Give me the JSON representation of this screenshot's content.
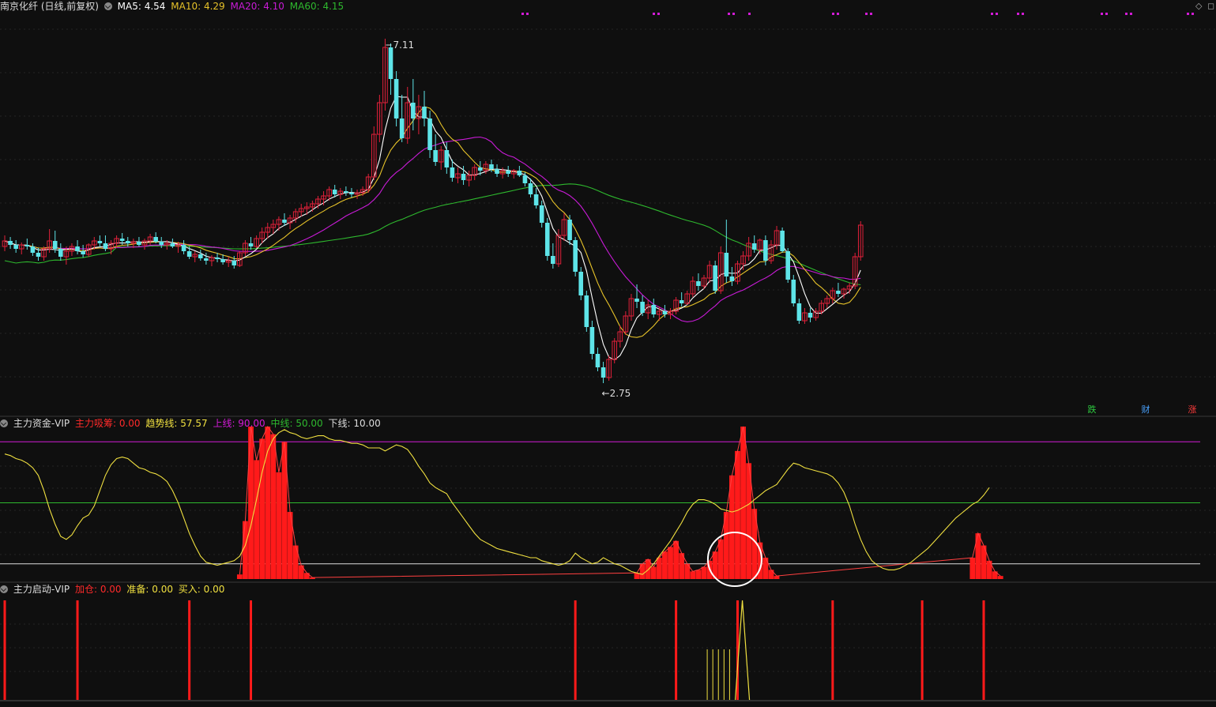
{
  "header": {
    "title": "南京化纤 (日线,前复权)",
    "ma": [
      {
        "label": "MA5: 4.54",
        "color": "#ffffff"
      },
      {
        "label": "MA10: 4.29",
        "color": "#e6c229"
      },
      {
        "label": "MA20: 4.10",
        "color": "#c81bd6"
      },
      {
        "label": "MA60: 4.15",
        "color": "#2eb82e"
      }
    ]
  },
  "price_labels": {
    "high": "7.11",
    "low": "2.75"
  },
  "right_badges": [
    {
      "label": "跌",
      "color": "#2ecc40"
    },
    {
      "label": "财",
      "color": "#4aa3ff"
    },
    {
      "label": "涨",
      "color": "#ff3b3b"
    }
  ],
  "panel2": {
    "title": "主力资金-VIP",
    "items": [
      {
        "label": "主力吸筹: 0.00",
        "color": "#ff2a2a"
      },
      {
        "label": "趋势线: 57.57",
        "color": "#f0e040"
      },
      {
        "label": "上线: 90.00",
        "color": "#d21bd6"
      },
      {
        "label": "中线: 50.00",
        "color": "#2eb82e"
      },
      {
        "label": "下线: 10.00",
        "color": "#dddddd"
      }
    ]
  },
  "panel3": {
    "title": "主力启动-VIP",
    "items": [
      {
        "label": "加仓: 0.00",
        "color": "#ff2a2a"
      },
      {
        "label": "准备: 0.00",
        "color": "#f0e040"
      },
      {
        "label": "买入: 0.00",
        "color": "#f0e040"
      }
    ]
  },
  "chart_data": [
    {
      "type": "candlestick",
      "title": "南京化纤 (日线,前复权)",
      "ylim": [
        2.5,
        7.4
      ],
      "y_markers": {
        "max": 7.11,
        "min": 2.75
      },
      "ohlc": [
        [
          4.48,
          4.62,
          4.42,
          4.55
        ],
        [
          4.55,
          4.6,
          4.45,
          4.5
        ],
        [
          4.5,
          4.56,
          4.4,
          4.45
        ],
        [
          4.45,
          4.53,
          4.38,
          4.5
        ],
        [
          4.5,
          4.58,
          4.44,
          4.48
        ],
        [
          4.48,
          4.52,
          4.36,
          4.4
        ],
        [
          4.4,
          4.46,
          4.3,
          4.35
        ],
        [
          4.35,
          4.48,
          4.3,
          4.45
        ],
        [
          4.45,
          4.7,
          4.4,
          4.55
        ],
        [
          4.55,
          4.68,
          4.4,
          4.45
        ],
        [
          4.45,
          4.52,
          4.3,
          4.35
        ],
        [
          4.35,
          4.48,
          4.25,
          4.42
        ],
        [
          4.42,
          4.52,
          4.36,
          4.48
        ],
        [
          4.48,
          4.56,
          4.38,
          4.42
        ],
        [
          4.42,
          4.5,
          4.34,
          4.38
        ],
        [
          4.38,
          4.52,
          4.35,
          4.5
        ],
        [
          4.5,
          4.6,
          4.44,
          4.55
        ],
        [
          4.55,
          4.62,
          4.47,
          4.52
        ],
        [
          4.52,
          4.62,
          4.42,
          4.45
        ],
        [
          4.45,
          4.56,
          4.38,
          4.52
        ],
        [
          4.52,
          4.62,
          4.46,
          4.58
        ],
        [
          4.58,
          4.65,
          4.5,
          4.55
        ],
        [
          4.55,
          4.6,
          4.48,
          4.52
        ],
        [
          4.52,
          4.58,
          4.46,
          4.54
        ],
        [
          4.54,
          4.6,
          4.48,
          4.5
        ],
        [
          4.5,
          4.58,
          4.44,
          4.55
        ],
        [
          4.55,
          4.64,
          4.5,
          4.6
        ],
        [
          4.6,
          4.66,
          4.52,
          4.54
        ],
        [
          4.54,
          4.6,
          4.46,
          4.5
        ],
        [
          4.5,
          4.56,
          4.44,
          4.52
        ],
        [
          4.52,
          4.58,
          4.46,
          4.48
        ],
        [
          4.48,
          4.54,
          4.4,
          4.5
        ],
        [
          4.5,
          4.56,
          4.38,
          4.42
        ],
        [
          4.42,
          4.48,
          4.32,
          4.35
        ],
        [
          4.35,
          4.42,
          4.28,
          4.38
        ],
        [
          4.38,
          4.44,
          4.3,
          4.33
        ],
        [
          4.33,
          4.4,
          4.25,
          4.3
        ],
        [
          4.3,
          4.37,
          4.23,
          4.34
        ],
        [
          4.34,
          4.4,
          4.28,
          4.32
        ],
        [
          4.32,
          4.38,
          4.25,
          4.28
        ],
        [
          4.28,
          4.35,
          4.22,
          4.3
        ],
        [
          4.3,
          4.36,
          4.2,
          4.24
        ],
        [
          4.24,
          4.42,
          4.22,
          4.4
        ],
        [
          4.4,
          4.56,
          4.36,
          4.52
        ],
        [
          4.52,
          4.6,
          4.44,
          4.48
        ],
        [
          4.48,
          4.62,
          4.46,
          4.58
        ],
        [
          4.58,
          4.72,
          4.52,
          4.66
        ],
        [
          4.66,
          4.78,
          4.58,
          4.72
        ],
        [
          4.72,
          4.82,
          4.64,
          4.76
        ],
        [
          4.76,
          4.86,
          4.68,
          4.82
        ],
        [
          4.82,
          4.9,
          4.74,
          4.78
        ],
        [
          4.78,
          4.88,
          4.7,
          4.84
        ],
        [
          4.84,
          4.96,
          4.78,
          4.92
        ],
        [
          4.92,
          5.02,
          4.86,
          4.96
        ],
        [
          4.96,
          5.04,
          4.88,
          4.98
        ],
        [
          4.98,
          5.06,
          4.92,
          5.02
        ],
        [
          5.02,
          5.12,
          4.96,
          5.08
        ],
        [
          5.08,
          5.18,
          5.0,
          5.12
        ],
        [
          5.12,
          5.24,
          5.06,
          5.2
        ],
        [
          5.2,
          5.26,
          5.1,
          5.14
        ],
        [
          5.14,
          5.22,
          5.08,
          5.18
        ],
        [
          5.18,
          5.24,
          5.12,
          5.16
        ],
        [
          5.16,
          5.22,
          5.1,
          5.14
        ],
        [
          5.14,
          5.2,
          5.08,
          5.16
        ],
        [
          5.16,
          5.24,
          5.12,
          5.2
        ],
        [
          5.2,
          5.4,
          5.16,
          5.36
        ],
        [
          5.36,
          6.0,
          5.32,
          5.9
        ],
        [
          5.9,
          6.4,
          5.8,
          6.3
        ],
        [
          6.3,
          7.11,
          6.2,
          7.0
        ],
        [
          7.0,
          7.05,
          6.4,
          6.6
        ],
        [
          6.6,
          6.7,
          6.0,
          6.1
        ],
        [
          6.1,
          6.4,
          5.8,
          5.85
        ],
        [
          5.85,
          6.5,
          5.78,
          6.3
        ],
        [
          6.3,
          6.6,
          5.95,
          6.1
        ],
        [
          6.1,
          6.4,
          5.9,
          6.25
        ],
        [
          6.25,
          6.45,
          6.0,
          6.1
        ],
        [
          6.1,
          6.2,
          5.6,
          5.7
        ],
        [
          5.7,
          5.9,
          5.5,
          5.55
        ],
        [
          5.55,
          5.75,
          5.45,
          5.7
        ],
        [
          5.7,
          5.8,
          5.4,
          5.48
        ],
        [
          5.48,
          5.58,
          5.3,
          5.35
        ],
        [
          5.35,
          5.48,
          5.28,
          5.4
        ],
        [
          5.4,
          5.5,
          5.26,
          5.32
        ],
        [
          5.32,
          5.44,
          5.24,
          5.38
        ],
        [
          5.38,
          5.52,
          5.32,
          5.48
        ],
        [
          5.48,
          5.56,
          5.38,
          5.44
        ],
        [
          5.44,
          5.56,
          5.4,
          5.52
        ],
        [
          5.52,
          5.58,
          5.42,
          5.46
        ],
        [
          5.46,
          5.52,
          5.36,
          5.4
        ],
        [
          5.4,
          5.48,
          5.34,
          5.44
        ],
        [
          5.44,
          5.5,
          5.36,
          5.4
        ],
        [
          5.4,
          5.46,
          5.34,
          5.44
        ],
        [
          5.44,
          5.5,
          5.36,
          5.38
        ],
        [
          5.38,
          5.42,
          5.24,
          5.28
        ],
        [
          5.28,
          5.34,
          5.1,
          5.14
        ],
        [
          5.14,
          5.22,
          4.96,
          5.0
        ],
        [
          5.0,
          5.06,
          4.72,
          4.78
        ],
        [
          4.78,
          4.84,
          4.3,
          4.36
        ],
        [
          4.36,
          4.52,
          4.2,
          4.26
        ],
        [
          4.26,
          4.7,
          4.22,
          4.62
        ],
        [
          4.62,
          4.9,
          4.55,
          4.82
        ],
        [
          4.82,
          4.88,
          4.5,
          4.56
        ],
        [
          4.56,
          4.6,
          4.1,
          4.16
        ],
        [
          4.16,
          4.22,
          3.8,
          3.86
        ],
        [
          3.86,
          3.92,
          3.4,
          3.46
        ],
        [
          3.46,
          3.54,
          3.05,
          3.12
        ],
        [
          3.12,
          3.2,
          2.9,
          2.95
        ],
        [
          2.95,
          3.02,
          2.75,
          2.82
        ],
        [
          2.82,
          3.1,
          2.78,
          3.05
        ],
        [
          3.05,
          3.32,
          3.0,
          3.28
        ],
        [
          3.28,
          3.48,
          3.2,
          3.4
        ],
        [
          3.4,
          3.66,
          3.36,
          3.6
        ],
        [
          3.6,
          3.88,
          3.54,
          3.82
        ],
        [
          3.82,
          4.0,
          3.7,
          3.78
        ],
        [
          3.78,
          3.86,
          3.6,
          3.64
        ],
        [
          3.64,
          3.8,
          3.56,
          3.74
        ],
        [
          3.74,
          3.82,
          3.58,
          3.62
        ],
        [
          3.62,
          3.72,
          3.54,
          3.66
        ],
        [
          3.66,
          3.74,
          3.58,
          3.62
        ],
        [
          3.62,
          3.7,
          3.56,
          3.66
        ],
        [
          3.66,
          3.84,
          3.62,
          3.8
        ],
        [
          3.8,
          3.9,
          3.72,
          3.76
        ],
        [
          3.76,
          3.92,
          3.74,
          3.88
        ],
        [
          3.88,
          4.1,
          3.84,
          4.04
        ],
        [
          4.04,
          4.14,
          3.92,
          3.98
        ],
        [
          3.98,
          4.12,
          3.94,
          4.08
        ],
        [
          4.08,
          4.3,
          4.02,
          4.24
        ],
        [
          4.24,
          4.3,
          3.88,
          3.92
        ],
        [
          3.92,
          4.48,
          3.88,
          4.4
        ],
        [
          4.4,
          4.82,
          4.02,
          4.1
        ],
        [
          4.1,
          4.22,
          3.98,
          4.04
        ],
        [
          4.04,
          4.3,
          4.0,
          4.26
        ],
        [
          4.26,
          4.42,
          4.18,
          4.36
        ],
        [
          4.36,
          4.6,
          4.3,
          4.52
        ],
        [
          4.52,
          4.62,
          4.4,
          4.44
        ],
        [
          4.44,
          4.58,
          4.38,
          4.56
        ],
        [
          4.56,
          4.62,
          4.24,
          4.3
        ],
        [
          4.3,
          4.56,
          4.26,
          4.5
        ],
        [
          4.5,
          4.74,
          4.44,
          4.68
        ],
        [
          4.68,
          4.72,
          4.4,
          4.42
        ],
        [
          4.42,
          4.46,
          4.02,
          4.06
        ],
        [
          4.06,
          4.12,
          3.72,
          3.76
        ],
        [
          3.76,
          3.82,
          3.5,
          3.54
        ],
        [
          3.54,
          3.7,
          3.5,
          3.64
        ],
        [
          3.64,
          3.7,
          3.52,
          3.58
        ],
        [
          3.58,
          3.7,
          3.54,
          3.66
        ],
        [
          3.66,
          3.8,
          3.62,
          3.76
        ],
        [
          3.76,
          3.86,
          3.7,
          3.82
        ],
        [
          3.82,
          3.96,
          3.76,
          3.92
        ],
        [
          3.92,
          4.02,
          3.84,
          3.88
        ],
        [
          3.88,
          3.96,
          3.82,
          3.94
        ],
        [
          3.94,
          4.02,
          3.88,
          3.98
        ],
        [
          3.98,
          4.4,
          3.94,
          4.35
        ],
        [
          4.35,
          4.8,
          4.3,
          4.75
        ]
      ],
      "ma": {
        "MA5": 4.54,
        "MA10": 4.29,
        "MA20": 4.1,
        "MA60": 4.15
      }
    },
    {
      "type": "bar+line",
      "title": "主力资金-VIP",
      "ylim": [
        0,
        100
      ],
      "hlines": {
        "上线": 90,
        "中线": 50,
        "下线": 10
      },
      "trend_line": [
        82,
        81,
        79,
        78,
        76,
        73,
        68,
        58,
        46,
        36,
        28,
        26,
        29,
        35,
        40,
        42,
        48,
        58,
        68,
        75,
        79,
        80,
        79,
        76,
        73,
        72,
        70,
        69,
        67,
        64,
        58,
        50,
        40,
        30,
        22,
        15,
        11,
        10,
        9,
        10,
        11,
        12,
        15,
        22,
        35,
        52,
        70,
        84,
        92,
        96,
        98,
        96,
        95,
        93,
        92,
        93,
        94,
        94,
        92,
        91,
        91,
        90,
        89,
        89,
        88,
        86,
        86,
        86,
        84,
        86,
        88,
        87,
        85,
        80,
        74,
        69,
        63,
        60,
        58,
        56,
        50,
        45,
        40,
        35,
        30,
        26,
        24,
        22,
        20,
        19,
        18,
        17,
        16,
        15,
        14,
        14,
        12,
        11,
        10,
        9,
        10,
        12,
        17,
        14,
        12,
        10,
        11,
        14,
        12,
        10,
        9,
        7,
        5,
        4,
        3,
        6,
        10,
        15,
        20,
        25,
        31,
        37,
        44,
        49,
        52,
        52,
        51,
        49,
        46,
        45,
        44,
        45,
        47,
        49,
        52,
        55,
        58,
        60,
        62,
        67,
        72,
        76,
        75,
        73,
        72,
        71,
        70,
        69,
        67,
        63,
        57,
        48,
        36,
        26,
        18,
        12,
        9,
        7,
        6,
        6,
        7,
        9,
        11,
        14,
        17,
        20,
        24,
        28,
        32,
        36,
        40,
        43,
        46,
        49,
        51,
        55,
        60
      ],
      "accumulation_bars": [
        [
          42,
          3
        ],
        [
          43,
          38
        ],
        [
          44,
          100
        ],
        [
          45,
          78
        ],
        [
          46,
          92
        ],
        [
          47,
          100
        ],
        [
          48,
          95
        ],
        [
          49,
          70
        ],
        [
          50,
          90
        ],
        [
          51,
          44
        ],
        [
          52,
          22
        ],
        [
          53,
          9
        ],
        [
          54,
          4
        ],
        [
          55,
          1
        ],
        [
          113,
          4
        ],
        [
          114,
          10
        ],
        [
          115,
          13
        ],
        [
          116,
          8
        ],
        [
          117,
          14
        ],
        [
          118,
          18
        ],
        [
          119,
          21
        ],
        [
          120,
          25
        ],
        [
          121,
          17
        ],
        [
          122,
          10
        ],
        [
          123,
          5
        ],
        [
          124,
          6
        ],
        [
          125,
          8
        ],
        [
          126,
          12
        ],
        [
          127,
          18
        ],
        [
          128,
          26
        ],
        [
          129,
          44
        ],
        [
          130,
          68
        ],
        [
          131,
          84
        ],
        [
          132,
          100
        ],
        [
          133,
          76
        ],
        [
          134,
          46
        ],
        [
          135,
          24
        ],
        [
          136,
          14
        ],
        [
          137,
          6
        ],
        [
          138,
          2
        ],
        [
          173,
          14
        ],
        [
          174,
          30
        ],
        [
          175,
          22
        ],
        [
          176,
          12
        ],
        [
          177,
          5
        ],
        [
          178,
          2
        ]
      ]
    },
    {
      "type": "bar",
      "title": "主力启动-VIP",
      "ylim": [
        0,
        100
      ],
      "add_position_bars": [
        0,
        13,
        33,
        44,
        102,
        120,
        131,
        148,
        164,
        175
      ],
      "prepare_bars": [
        126,
        127,
        128,
        129,
        130
      ],
      "buy_spike": 132
    }
  ],
  "colors": {
    "up": "#e2203a",
    "down": "#5ee4e8",
    "background": "#0f0f0f",
    "grid": "#262626"
  }
}
